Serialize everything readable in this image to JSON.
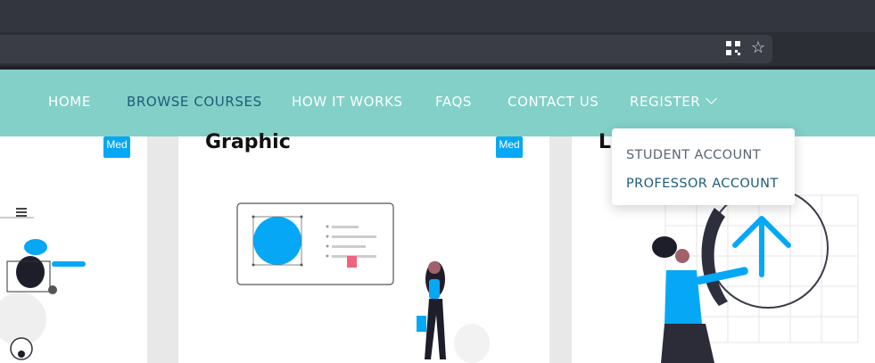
{
  "browser": {
    "qr_icon": "qr-code-icon",
    "star_icon": "star-icon"
  },
  "nav": {
    "items": [
      {
        "label": "HOME"
      },
      {
        "label": "BROWSE COURSES"
      },
      {
        "label": "HOW IT WORKS"
      },
      {
        "label": "FAQS"
      },
      {
        "label": "CONTACT US"
      },
      {
        "label": "REGISTER"
      }
    ],
    "active_color": "#1f5c78",
    "background": "#82d0c8"
  },
  "dropdown": {
    "items": [
      {
        "label": "STUDENT ACCOUNT"
      },
      {
        "label": "PROFESSOR ACCOUNT"
      }
    ]
  },
  "cards": [
    {
      "badge": "Med"
    },
    {
      "title": "Graphic",
      "badge": "Med"
    },
    {
      "title": "L"
    }
  ]
}
